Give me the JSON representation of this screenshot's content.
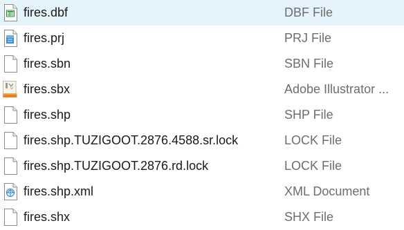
{
  "files": [
    {
      "name": "fires.dbf",
      "type": "DBF File",
      "icon": "dbf-file-icon"
    },
    {
      "name": "fires.prj",
      "type": "PRJ File",
      "icon": "prj-file-icon"
    },
    {
      "name": "fires.sbn",
      "type": "SBN File",
      "icon": "blank-file-icon"
    },
    {
      "name": "fires.sbx",
      "type": "Adobe Illustrator ...",
      "icon": "illustrator-file-icon"
    },
    {
      "name": "fires.shp",
      "type": "SHP File",
      "icon": "blank-file-icon"
    },
    {
      "name": "fires.shp.TUZIGOOT.2876.4588.sr.lock",
      "type": "LOCK File",
      "icon": "blank-file-icon"
    },
    {
      "name": "fires.shp.TUZIGOOT.2876.rd.lock",
      "type": "LOCK File",
      "icon": "blank-file-icon"
    },
    {
      "name": "fires.shp.xml",
      "type": "XML Document",
      "icon": "xml-file-icon"
    },
    {
      "name": "fires.shx",
      "type": "SHX File",
      "icon": "blank-file-icon"
    }
  ]
}
